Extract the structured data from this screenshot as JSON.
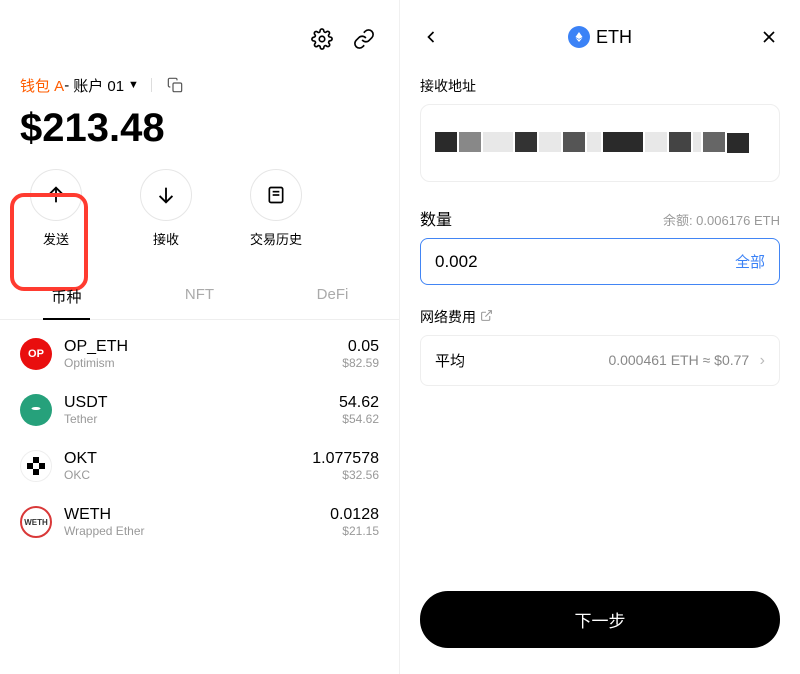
{
  "left": {
    "wallet_name": "钱包 A",
    "account_sep": " - ",
    "account_label": "账户 01",
    "balance": "$213.48",
    "actions": {
      "send": "发送",
      "receive": "接收",
      "history": "交易历史"
    },
    "tabs": {
      "tokens": "币种",
      "nft": "NFT",
      "defi": "DeFi"
    },
    "tokens": [
      {
        "sym": "OP_ETH",
        "chain": "Optimism",
        "amt": "0.05",
        "fiat": "$82.59"
      },
      {
        "sym": "USDT",
        "chain": "Tether",
        "amt": "54.62",
        "fiat": "$54.62"
      },
      {
        "sym": "OKT",
        "chain": "OKC",
        "amt": "1.077578",
        "fiat": "$32.56"
      },
      {
        "sym": "WETH",
        "chain": "Wrapped Ether",
        "amt": "0.0128",
        "fiat": "$21.15"
      }
    ]
  },
  "right": {
    "title": "ETH",
    "addr_label": "接收地址",
    "amount_label": "数量",
    "balance_hint": "余额: 0.006176 ETH",
    "amount_value": "0.002",
    "all_label": "全部",
    "fee_label": "网络费用",
    "fee_tier": "平均",
    "fee_value": "0.000461 ETH ≈ $0.77",
    "next": "下一步"
  }
}
